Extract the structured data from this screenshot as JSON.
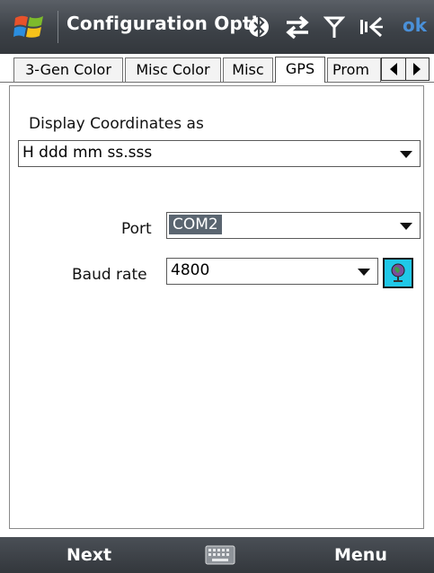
{
  "titlebar": {
    "title": "Configuration Opti",
    "ok_label": "ok"
  },
  "icons": {
    "start": "windows-flag-icon",
    "bluetooth": "bluetooth-icon",
    "connectivity": "connectivity-arrows-icon",
    "signal": "antenna-signal-icon",
    "volume": "speaker-muted-icon",
    "globe": "globe-icon",
    "keyboard": "keyboard-icon"
  },
  "tabs": [
    {
      "label": "3-Gen Color"
    },
    {
      "label": "Misc Color"
    },
    {
      "label": "Misc"
    },
    {
      "label": "GPS"
    },
    {
      "label": "Prom"
    }
  ],
  "active_tab": "GPS",
  "form": {
    "display_coordinates_label": "Display Coordinates as",
    "display_coordinates_value": "H ddd mm ss.sss",
    "port_label": "Port",
    "port_value": "COM2",
    "baud_label": "Baud rate",
    "baud_value": "4800"
  },
  "menubar": {
    "left_label": "Next",
    "right_label": "Menu"
  },
  "colors": {
    "titlebar": "#3d4248",
    "ok": "#4a90d8",
    "globe_button": "#20c8e8",
    "selection": "#5a6570"
  }
}
